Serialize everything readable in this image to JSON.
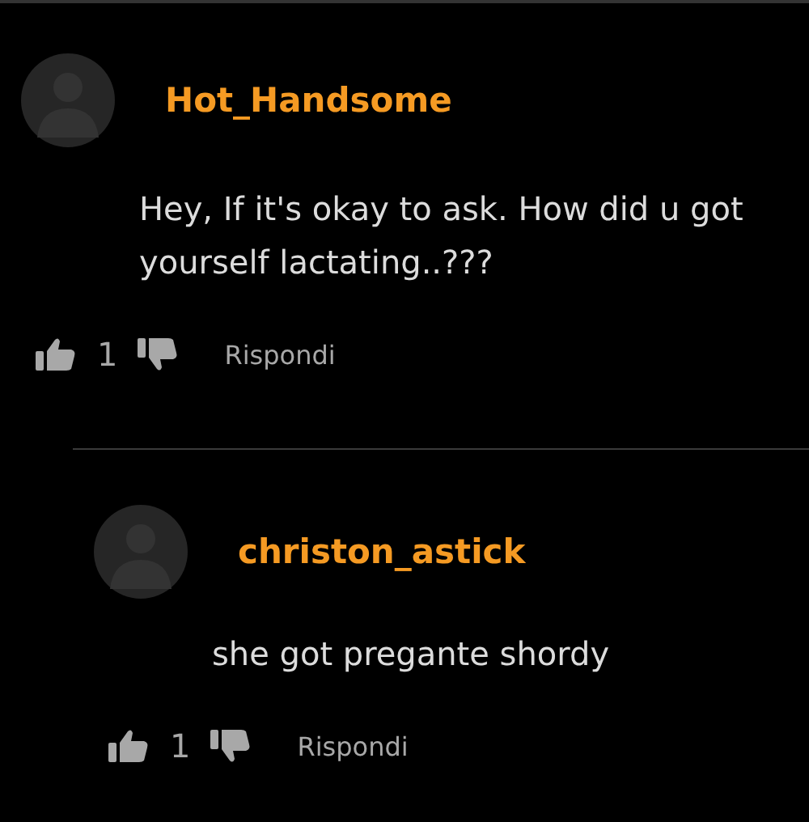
{
  "comments": [
    {
      "author": "Hot_Handsome",
      "text": "Hey, If it's okay to ask. How did u got yourself lactating..???",
      "likes": "1",
      "reply_label": "Rispondi",
      "children": [
        {
          "author": "christon_astick",
          "text": "she got pregante shordy",
          "likes": "1",
          "reply_label": "Rispondi"
        }
      ]
    }
  ]
}
